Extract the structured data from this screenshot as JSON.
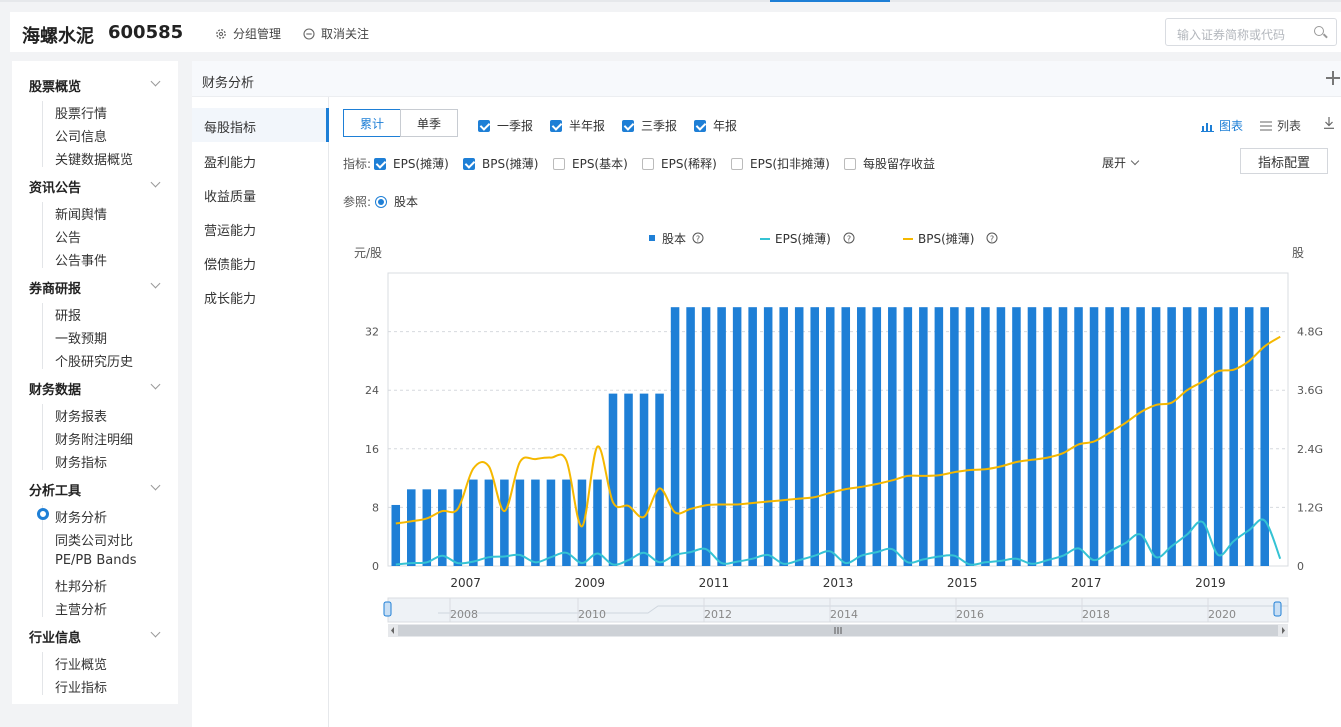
{
  "header": {
    "stock_name": "海螺水泥",
    "stock_code": "600585",
    "group_manage": "分组管理",
    "unfollow": "取消关注",
    "search_placeholder": "输入证券简称或代码"
  },
  "sidebar": {
    "groups": [
      {
        "label": "股票概览",
        "items": [
          "股票行情",
          "公司信息",
          "关键数据概览"
        ]
      },
      {
        "label": "资讯公告",
        "items": [
          "新闻舆情",
          "公告",
          "公告事件"
        ]
      },
      {
        "label": "券商研报",
        "items": [
          "研报",
          "一致预期",
          "个股研究历史"
        ]
      },
      {
        "label": "财务数据",
        "items": [
          "财务报表",
          "财务附注明细",
          "财务指标"
        ]
      },
      {
        "label": "分析工具",
        "items": [
          "财务分析",
          "同类公司对比",
          "PE/PB Bands",
          "杜邦分析",
          "主营分析"
        ]
      },
      {
        "label": "行业信息",
        "items": [
          "行业概览",
          "行业指标"
        ]
      }
    ],
    "active_item": "财务分析"
  },
  "main": {
    "title": "财务分析",
    "subnav": [
      "每股指标",
      "盈利能力",
      "收益质量",
      "营运能力",
      "偿债能力",
      "成长能力"
    ],
    "active_subnav": "每股指标",
    "mode_tabs": [
      "累计",
      "单季"
    ],
    "active_mode": "累计",
    "periods": [
      {
        "label": "一季报",
        "checked": true
      },
      {
        "label": "半年报",
        "checked": true
      },
      {
        "label": "三季报",
        "checked": true
      },
      {
        "label": "年报",
        "checked": true
      }
    ],
    "view_chart": "图表",
    "view_list": "列表",
    "indicator_label": "指标:",
    "indicators": [
      {
        "label": "EPS(摊薄)",
        "checked": true
      },
      {
        "label": "BPS(摊薄)",
        "checked": true
      },
      {
        "label": "EPS(基本)",
        "checked": false
      },
      {
        "label": "EPS(稀释)",
        "checked": false
      },
      {
        "label": "EPS(扣非摊薄)",
        "checked": false
      },
      {
        "label": "每股留存收益",
        "checked": false
      }
    ],
    "expand": "展开",
    "config_button": "指标配置",
    "reference_label": "参照:",
    "reference_value": "股本"
  },
  "colors": {
    "accent": "#1e7fd6",
    "bar": "#1e7fd6",
    "eps": "#35c3d4",
    "bps": "#f5b800"
  },
  "chart_data": {
    "type": "bar",
    "legend": [
      "股本",
      "EPS(摊薄)",
      "BPS(摊薄)"
    ],
    "y_left_unit": "元/股",
    "y_right_unit": "股",
    "y_left_ticks": [
      "0",
      "8",
      "16",
      "24",
      "32"
    ],
    "y_right_ticks": [
      "0",
      "1.2G",
      "2.4G",
      "3.6G",
      "4.8G"
    ],
    "ylim_left": [
      0,
      40
    ],
    "ylim_right": [
      0,
      6.0
    ],
    "x_ticks": [
      "2007",
      "2009",
      "2011",
      "2013",
      "2015",
      "2017",
      "2019"
    ],
    "slider_ticks": [
      "2008",
      "2010",
      "2012",
      "2014",
      "2016",
      "2018",
      "2020"
    ],
    "period_start": "2006Q3",
    "shares_G": [
      1.25,
      1.57,
      1.57,
      1.57,
      1.57,
      1.77,
      1.77,
      1.77,
      1.77,
      1.77,
      1.77,
      1.77,
      1.77,
      1.77,
      3.53,
      3.53,
      3.53,
      3.53,
      5.3,
      5.3,
      5.3,
      5.3,
      5.3,
      5.3,
      5.3,
      5.3,
      5.3,
      5.3,
      5.3,
      5.3,
      5.3,
      5.3,
      5.3,
      5.3,
      5.3,
      5.3,
      5.3,
      5.3,
      5.3,
      5.3,
      5.3,
      5.3,
      5.3,
      5.3,
      5.3,
      5.3,
      5.3,
      5.3,
      5.3,
      5.3,
      5.3,
      5.3,
      5.3,
      5.3,
      5.3,
      5.3,
      5.3
    ],
    "eps": [
      0.2,
      0.4,
      0.5,
      1.4,
      0.4,
      0.6,
      1.2,
      1.3,
      1.5,
      0.5,
      1.2,
      1.8,
      0.4,
      1.7,
      0.2,
      0.8,
      1.8,
      0.5,
      1.5,
      1.9,
      2.3,
      0.4,
      0.6,
      1.0,
      1.5,
      0.3,
      0.8,
      1.4,
      2.0,
      0.4,
      1.4,
      1.9,
      2.3,
      0.5,
      0.9,
      1.3,
      1.4,
      0.2,
      0.5,
      0.7,
      1.0,
      0.3,
      0.8,
      1.4,
      2.4,
      0.8,
      2.0,
      3.1,
      4.3,
      1.2,
      2.7,
      4.3,
      6.0,
      1.5,
      3.4,
      4.9,
      6.2,
      1.0
    ],
    "bps": [
      5.8,
      6.1,
      6.5,
      7.5,
      7.8,
      13.3,
      13.6,
      7.5,
      14.2,
      14.6,
      14.8,
      14.4,
      5.4,
      16.3,
      8.7,
      8.2,
      6.7,
      10.6,
      7.3,
      7.8,
      8.3,
      8.4,
      8.4,
      8.6,
      8.8,
      9.0,
      9.2,
      9.4,
      10.0,
      10.5,
      10.8,
      11.2,
      11.7,
      12.3,
      12.3,
      12.4,
      12.8,
      13.1,
      13.2,
      13.6,
      14.2,
      14.5,
      14.8,
      15.4,
      16.6,
      17.0,
      18.2,
      19.5,
      21.0,
      22.0,
      22.3,
      24.0,
      25.2,
      26.6,
      26.8,
      28.0,
      30.0,
      31.3
    ]
  }
}
